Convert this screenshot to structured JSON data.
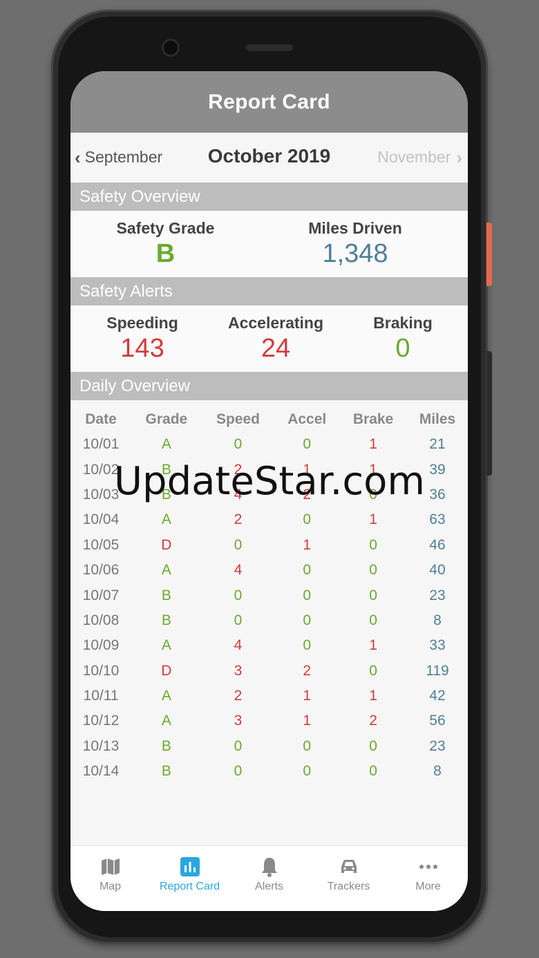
{
  "header": {
    "title": "Report Card"
  },
  "month_nav": {
    "prev": "September",
    "current": "October 2019",
    "next": "November"
  },
  "safety_overview": {
    "title": "Safety Overview",
    "grade_label": "Safety Grade",
    "grade_value": "B",
    "miles_label": "Miles Driven",
    "miles_value": "1,348"
  },
  "safety_alerts": {
    "title": "Safety Alerts",
    "speeding_label": "Speeding",
    "speeding_value": "143",
    "accel_label": "Accelerating",
    "accel_value": "24",
    "braking_label": "Braking",
    "braking_value": "0"
  },
  "daily_overview": {
    "title": "Daily Overview",
    "columns": [
      "Date",
      "Grade",
      "Speed",
      "Accel",
      "Brake",
      "Miles"
    ],
    "rows": [
      [
        "10/01",
        "A",
        "0",
        "0",
        "1",
        "21"
      ],
      [
        "10/02",
        "B",
        "2",
        "1",
        "1",
        "39"
      ],
      [
        "10/03",
        "B",
        "4",
        "2",
        "0",
        "36"
      ],
      [
        "10/04",
        "A",
        "2",
        "0",
        "1",
        "63"
      ],
      [
        "10/05",
        "D",
        "0",
        "1",
        "0",
        "46"
      ],
      [
        "10/06",
        "A",
        "4",
        "0",
        "0",
        "40"
      ],
      [
        "10/07",
        "B",
        "0",
        "0",
        "0",
        "23"
      ],
      [
        "10/08",
        "B",
        "0",
        "0",
        "0",
        "8"
      ],
      [
        "10/09",
        "A",
        "4",
        "0",
        "1",
        "33"
      ],
      [
        "10/10",
        "D",
        "3",
        "2",
        "0",
        "119"
      ],
      [
        "10/11",
        "A",
        "2",
        "1",
        "1",
        "42"
      ],
      [
        "10/12",
        "A",
        "3",
        "1",
        "2",
        "56"
      ],
      [
        "10/13",
        "B",
        "0",
        "0",
        "0",
        "23"
      ],
      [
        "10/14",
        "B",
        "0",
        "0",
        "0",
        "8"
      ]
    ]
  },
  "tabs": [
    {
      "label": "Map",
      "icon": "map-icon"
    },
    {
      "label": "Report Card",
      "icon": "bar-chart-icon",
      "active": true
    },
    {
      "label": "Alerts",
      "icon": "bell-icon"
    },
    {
      "label": "Trackers",
      "icon": "car-icon"
    },
    {
      "label": "More",
      "icon": "more-icon"
    }
  ],
  "watermark": "UpdateStar.com",
  "colors": {
    "good": "#6aaa30",
    "bad": "#d23b3b",
    "miles": "#4f7f99",
    "accent": "#2aa7e0",
    "header_bg": "#8c8c8c",
    "section_bg": "#bdbdbd"
  }
}
